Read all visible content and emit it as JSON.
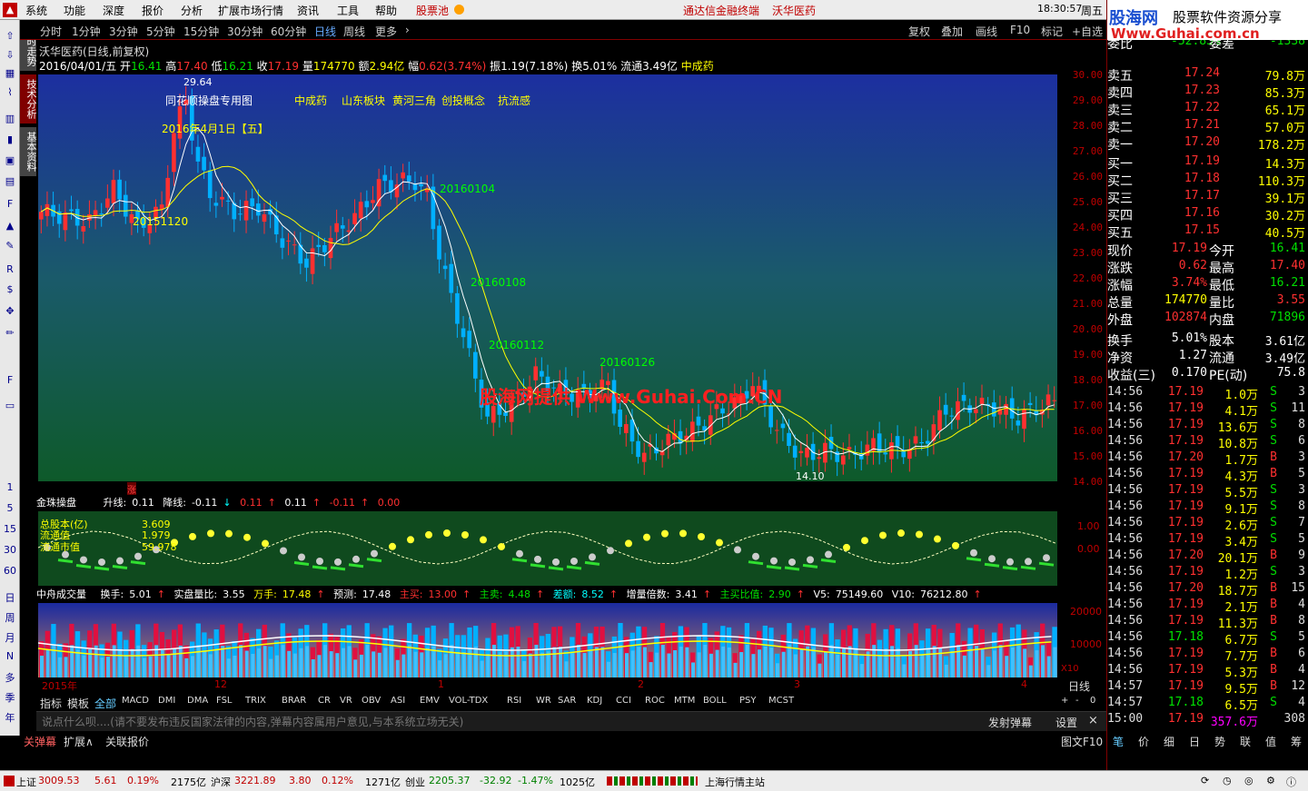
{
  "menu": {
    "items": [
      "系统",
      "功能",
      "深度",
      "报价",
      "分析",
      "扩展市场行情",
      "资讯",
      "工具",
      "帮助"
    ],
    "stock_pool": "股票池",
    "center_title": "通达信金融终端",
    "center_stock": "沃华医药",
    "clock": "18:30:57",
    "weekday": "周五"
  },
  "toolbar": {
    "periods": [
      "分时",
      "1分钟",
      "3分钟",
      "5分钟",
      "15分钟",
      "30分钟",
      "60分钟",
      "日线",
      "周线",
      "更多"
    ],
    "active": "日线",
    "right": [
      "复权",
      "叠加",
      "画线",
      "F10",
      "标记",
      "+自选"
    ]
  },
  "left_sidebar": {
    "vtabs": [
      "分时走势",
      "技术分析",
      "基本资料"
    ],
    "icons": [
      "up-icon",
      "down-icon",
      "grid-icon",
      "line-icon",
      "bar-icon",
      "candle-icon",
      "fin-icon",
      "doc-icon",
      "f10-icon",
      "fn-icon",
      "tool-icon",
      "rsi-icon",
      "money-icon",
      "move-icon",
      "pen-icon",
      "f5-icon",
      "screen-icon"
    ],
    "nums": [
      "1",
      "5",
      "15",
      "30",
      "60"
    ],
    "periods": [
      "日",
      "周",
      "月",
      "年"
    ],
    "nums2": [
      "N",
      "多",
      "季"
    ]
  },
  "quote": {
    "line1": "沃华医药(日线,前复权)",
    "date": "2016/04/01/五",
    "open_l": "开",
    "open": "16.41",
    "high_l": "高",
    "high": "17.40",
    "low_l": "低",
    "low": "16.21",
    "close_l": "收",
    "close": "17.19",
    "vol_l": "量",
    "vol": "174770",
    "amt_l": "额",
    "amt": "2.94亿",
    "chg_l": "幅",
    "chg": "0.62(3.74%)",
    "amp_l": "振",
    "amp": "1.19(7.18%)",
    "turn_l": "换",
    "turn": "5.01%",
    "float_l": "流通",
    "float": "3.49亿",
    "sector": "中成药"
  },
  "main_chart": {
    "labels": [
      "同花顺操盘专用图",
      "中成药",
      "山东板块",
      "黄河三角",
      "创投概念",
      "抗流感"
    ],
    "peak_label": "29.64",
    "date_label": "2016年4月1日【五】",
    "low_label": "14.10",
    "d1": "20151120",
    "d2": "20160104",
    "d3": "20160108",
    "d4": "20160112",
    "d5": "20160126",
    "watermark": "股海网提供 Www.Guhai.Com.CN",
    "mark": "涨"
  },
  "price_axis": [
    "30.00",
    "29.00",
    "28.00",
    "27.00",
    "26.00",
    "25.00",
    "24.00",
    "23.00",
    "22.00",
    "21.00",
    "20.00",
    "19.00",
    "18.00",
    "17.00",
    "16.00",
    "15.00",
    "14.00"
  ],
  "chart_data": {
    "type": "line",
    "x": [
      "2015-11",
      "2015-12",
      "2016-01",
      "2016-02",
      "2016-03",
      "2016-04"
    ],
    "series": [
      {
        "name": "收盘",
        "values": [
          24.5,
          27.5,
          25.0,
          17.5,
          15.0,
          17.19
        ]
      }
    ],
    "ylim": [
      14.0,
      30.0
    ]
  },
  "golden_bead": {
    "title": "金珠操盘",
    "up_l": "升线:",
    "up": "0.11",
    "down_l": "降线:",
    "down": "-0.11",
    "v1": "0.11",
    "v2": "0.11",
    "v3": "-0.11",
    "v4": "0.00",
    "legend": [
      "总股本(亿)",
      "流通值",
      "流通市值"
    ],
    "vals": [
      "3.609",
      "1.979",
      "59.978"
    ],
    "axis": [
      "1.00",
      "0.00"
    ]
  },
  "volume": {
    "title": "中舟成交量",
    "turn_l": "换手:",
    "turn": "5.01",
    "ratio_l": "实盘量比:",
    "ratio": "3.55",
    "wan_l": "万手:",
    "wan": "17.48",
    "pred_l": "预测:",
    "pred": "17.48",
    "buy_l": "主买:",
    "buy": "13.00",
    "sell_l": "主卖:",
    "sell": "4.48",
    "diff_l": "差额:",
    "diff": "8.52",
    "mul_l": "增量倍数:",
    "mul": "3.41",
    "bs_l": "主买比值:",
    "bs": "2.90",
    "v5_l": "V5:",
    "v5": "75149.60",
    "v10_l": "V10:",
    "v10": "76212.80",
    "axis": [
      "20000",
      "10000"
    ],
    "x10": "X10"
  },
  "time_axis": {
    "labels": [
      "2015年",
      "12",
      "1",
      "2",
      "3",
      "4"
    ],
    "period": "日线"
  },
  "indicator_tabs": {
    "items": [
      "指标",
      "模板",
      "全部",
      "MACD",
      "DMI",
      "DMA",
      "FSL",
      "TRIX",
      "BRAR",
      "CR",
      "VR",
      "OBV",
      "ASI",
      "EMV",
      "VOL-TDX",
      "RSI",
      "WR",
      "SAR",
      "KDJ",
      "CCI",
      "ROC",
      "MTM",
      "BOLL",
      "PSY",
      "MCST"
    ],
    "right": [
      "+",
      "-",
      "0"
    ]
  },
  "danmu": {
    "placeholder": "说点什么呗....(请不要发布违反国家法律的内容,弹幕内容属用户意见,与本系统立场无关)",
    "send": "发射弹幕",
    "settings": "设置",
    "close": "×"
  },
  "bottom_tabs": [
    "关弹幕",
    "扩展∧",
    "关联报价"
  ],
  "bottom_right": "图文F10",
  "status": {
    "sh_l": "上证",
    "sh": "3009.53",
    "sh_c": "5.61",
    "sh_p": "0.19%",
    "sh_a": "2175亿",
    "hs_l": "沪深",
    "hs": "3221.89",
    "hs_c": "3.80",
    "hs_p": "0.12%",
    "hs_a": "1271亿",
    "cy_l": "创业",
    "cy": "2205.37",
    "cy_c": "-32.92",
    "cy_p": "-1.47%",
    "cy_a": "1025亿",
    "station": "上海行情主站"
  },
  "brand": {
    "name": "股海网",
    "slogan": "股票软件资源分享",
    "url": "Www.Guhai.com.cn"
  },
  "orderbook": {
    "weibi_l": "委比",
    "weibi": "-52.83%",
    "weicha_l": "委差",
    "weicha": "-1338",
    "asks": [
      {
        "l": "卖五",
        "p": "17.24",
        "v": "79.8万"
      },
      {
        "l": "卖四",
        "p": "17.23",
        "v": "85.3万"
      },
      {
        "l": "卖三",
        "p": "17.22",
        "v": "65.1万"
      },
      {
        "l": "卖二",
        "p": "17.21",
        "v": "57.0万"
      },
      {
        "l": "卖一",
        "p": "17.20",
        "v": "178.2万"
      }
    ],
    "bids": [
      {
        "l": "买一",
        "p": "17.19",
        "v": "14.3万"
      },
      {
        "l": "买二",
        "p": "17.18",
        "v": "110.3万"
      },
      {
        "l": "买三",
        "p": "17.17",
        "v": "39.1万"
      },
      {
        "l": "买四",
        "p": "17.16",
        "v": "30.2万"
      },
      {
        "l": "买五",
        "p": "17.15",
        "v": "40.5万"
      }
    ]
  },
  "stats": [
    {
      "l1": "现价",
      "v1": "17.19",
      "c1": "red",
      "l2": "今开",
      "v2": "16.41",
      "c2": "grn"
    },
    {
      "l1": "涨跌",
      "v1": "0.62",
      "c1": "red",
      "l2": "最高",
      "v2": "17.40",
      "c2": "red"
    },
    {
      "l1": "涨幅",
      "v1": "3.74%",
      "c1": "red",
      "l2": "最低",
      "v2": "16.21",
      "c2": "grn"
    },
    {
      "l1": "总量",
      "v1": "174770",
      "c1": "yel",
      "l2": "量比",
      "v2": "3.55",
      "c2": "red"
    },
    {
      "l1": "外盘",
      "v1": "102874",
      "c1": "red",
      "l2": "内盘",
      "v2": "71896",
      "c2": "grn"
    },
    {
      "l1": "换手",
      "v1": "5.01%",
      "c1": "wht",
      "l2": "股本",
      "v2": "3.61亿",
      "c2": "wht"
    },
    {
      "l1": "净资",
      "v1": "1.27",
      "c1": "wht",
      "l2": "流通",
      "v2": "3.49亿",
      "c2": "wht"
    },
    {
      "l1": "收益(三)",
      "v1": "0.170",
      "c1": "wht",
      "l2": "PE(动)",
      "v2": "75.8",
      "c2": "wht"
    }
  ],
  "ticks": [
    {
      "t": "14:56",
      "p": "17.19",
      "v": "1.0万",
      "s": "S",
      "n": "3"
    },
    {
      "t": "14:56",
      "p": "17.19",
      "v": "4.1万",
      "s": "S",
      "n": "11"
    },
    {
      "t": "14:56",
      "p": "17.19",
      "v": "13.6万",
      "s": "S",
      "n": "8"
    },
    {
      "t": "14:56",
      "p": "17.19",
      "v": "10.8万",
      "s": "S",
      "n": "6"
    },
    {
      "t": "14:56",
      "p": "17.20",
      "v": "1.7万",
      "s": "B",
      "n": "3"
    },
    {
      "t": "14:56",
      "p": "17.19",
      "v": "4.3万",
      "s": "B",
      "n": "5"
    },
    {
      "t": "14:56",
      "p": "17.19",
      "v": "5.5万",
      "s": "S",
      "n": "3"
    },
    {
      "t": "14:56",
      "p": "17.19",
      "v": "9.1万",
      "s": "S",
      "n": "8"
    },
    {
      "t": "14:56",
      "p": "17.19",
      "v": "2.6万",
      "s": "S",
      "n": "7"
    },
    {
      "t": "14:56",
      "p": "17.19",
      "v": "3.4万",
      "s": "S",
      "n": "5"
    },
    {
      "t": "14:56",
      "p": "17.20",
      "v": "20.1万",
      "s": "B",
      "n": "9"
    },
    {
      "t": "14:56",
      "p": "17.19",
      "v": "1.2万",
      "s": "S",
      "n": "3"
    },
    {
      "t": "14:56",
      "p": "17.20",
      "v": "18.7万",
      "s": "B",
      "n": "15"
    },
    {
      "t": "14:56",
      "p": "17.19",
      "v": "2.1万",
      "s": "B",
      "n": "4"
    },
    {
      "t": "14:56",
      "p": "17.19",
      "v": "11.3万",
      "s": "B",
      "n": "8"
    },
    {
      "t": "14:56",
      "p": "17.18",
      "v": "6.7万",
      "s": "S",
      "n": "5"
    },
    {
      "t": "14:56",
      "p": "17.19",
      "v": "7.7万",
      "s": "B",
      "n": "6"
    },
    {
      "t": "14:56",
      "p": "17.19",
      "v": "5.3万",
      "s": "B",
      "n": "4"
    },
    {
      "t": "14:57",
      "p": "17.19",
      "v": "9.5万",
      "s": "B",
      "n": "12"
    },
    {
      "t": "14:57",
      "p": "17.18",
      "v": "6.5万",
      "s": "S",
      "n": "4"
    },
    {
      "t": "15:00",
      "p": "17.19",
      "v": "357.6万",
      "s": "",
      "n": "308"
    }
  ],
  "rp_tabs": [
    "笔",
    "价",
    "细",
    "日",
    "势",
    "联",
    "值",
    "筹"
  ]
}
